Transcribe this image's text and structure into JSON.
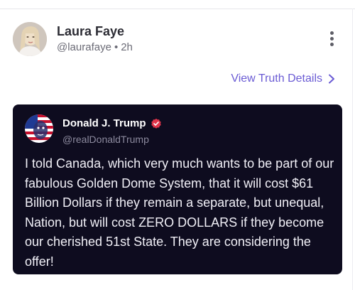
{
  "post": {
    "author_name": "Laura Faye",
    "author_handle": "@laurafaye",
    "separator": "•",
    "time_ago": "2h",
    "more_icon": "kebab-vertical-icon"
  },
  "details_link": {
    "label": "View Truth Details",
    "icon": "chevron-right-icon",
    "color": "#6a5bd4"
  },
  "quoted_post": {
    "author_name": "Donald J. Trump",
    "verified_icon": "verified-badge-icon",
    "verified_color": "#e0344a",
    "author_handle": "@realDonaldTrump",
    "text": "I told Canada, which very much wants to be part of our fabulous Golden Dome System, that it will cost $61 Billion Dollars if they remain a separate, but unequal, Nation, but will cost ZERO DOLLARS if they become our cherished 51st State. They are considering the offer!",
    "background": "#0e0c1f"
  }
}
